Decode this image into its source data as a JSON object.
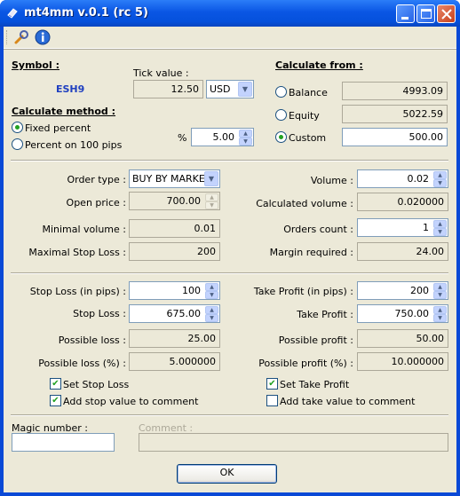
{
  "window": {
    "title": "mt4mm v.0.1 (rc 5)"
  },
  "toolbar": {
    "settings_icon": "wrench-icon",
    "info_icon": "info-icon"
  },
  "symbol": {
    "label": "Symbol :",
    "value": "ESH9"
  },
  "tick": {
    "label": "Tick value :",
    "value": "12.50",
    "currency": "USD"
  },
  "calc_from": {
    "label": "Calculate from :",
    "balance": {
      "label": "Balance",
      "value": "4993.09"
    },
    "equity": {
      "label": "Equity",
      "value": "5022.59"
    },
    "custom": {
      "label": "Custom",
      "value": "500.00",
      "selected": true
    }
  },
  "method": {
    "label": "Calculate method :",
    "fixed": "Fixed percent",
    "pips": "Percent on 100 pips",
    "pct_label": "%",
    "pct_value": "5.00"
  },
  "order": {
    "type_label": "Order type :",
    "type_value": "BUY BY MARKET",
    "open_label": "Open price :",
    "open_value": "700.00",
    "minvol_label": "Minimal volume :",
    "minvol_value": "0.01",
    "maxsl_label": "Maximal Stop Loss :",
    "maxsl_value": "200",
    "volume_label": "Volume :",
    "volume_value": "0.02",
    "calcvol_label": "Calculated volume :",
    "calcvol_value": "0.020000",
    "count_label": "Orders count :",
    "count_value": "1",
    "margin_label": "Margin required :",
    "margin_value": "24.00"
  },
  "stop": {
    "pips_label": "Stop Loss (in pips) :",
    "pips_value": "100",
    "sl_label": "Stop Loss :",
    "sl_value": "675.00",
    "loss_label": "Possible loss :",
    "loss_value": "25.00",
    "losspct_label": "Possible loss (%) :",
    "losspct_value": "5.000000",
    "set_label": "Set Stop Loss",
    "set_checked": true,
    "comment_label": "Add stop value to comment",
    "comment_checked": true
  },
  "take": {
    "pips_label": "Take Profit (in pips) :",
    "pips_value": "200",
    "tp_label": "Take Profit :",
    "tp_value": "750.00",
    "profit_label": "Possible profit :",
    "profit_value": "50.00",
    "profitpct_label": "Possible profit (%) :",
    "profitpct_value": "10.000000",
    "set_label": "Set Take Profit",
    "set_checked": true,
    "comment_label": "Add take value to comment",
    "comment_checked": false
  },
  "footer": {
    "magic_label": "Magic number :",
    "magic_value": "",
    "comment_label": "Comment :",
    "comment_value": "",
    "ok_label": "OK"
  }
}
